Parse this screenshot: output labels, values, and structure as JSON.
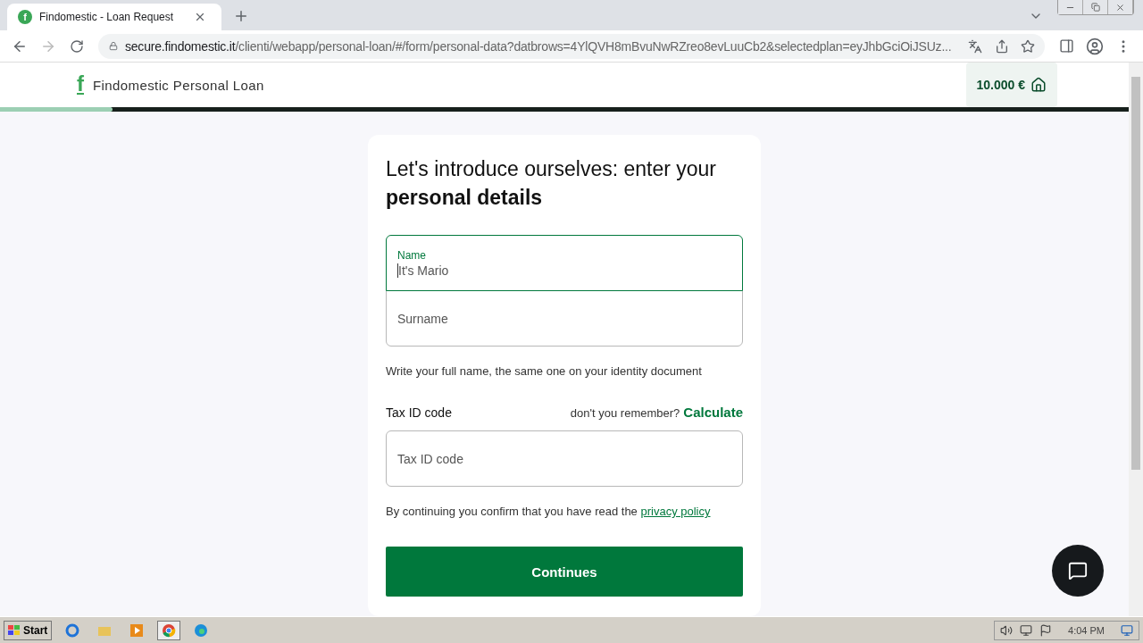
{
  "browser": {
    "tab": {
      "title": "Findomestic - Loan Request",
      "favicon": "f",
      "selected": true
    },
    "address": {
      "host": "secure.findomestic.it",
      "path": "/clienti/webapp/personal-loan/#/form/personal-data?datbrows=4YlQVH8mBvuNwRZreo8evLuuCb2&selectedplan=eyJhbGciOiJSUz..."
    }
  },
  "header": {
    "logo": "f",
    "brand": "Findomestic Personal Loan",
    "amount": "10.000 €",
    "progress": {
      "level": 0.1
    }
  },
  "form": {
    "heading": "Let's introduce ourselves: enter your **personal details**",
    "fields": [
      {
        "label": "Name",
        "placeholder": "It's Mario",
        "focused": true
      },
      {
        "placeholder": "Surname",
        "focused": false
      }
    ],
    "hint": "Write your full name, the same one on your identity document",
    "tax": {
      "label": "Tax ID code",
      "question": "don't you remember?",
      "link": "Calculate",
      "placeholder": "Tax ID code"
    },
    "consent": "By continuing you confirm that you have read the",
    "privacy_link": "privacy policy",
    "submit": "Continues"
  },
  "taskbar": {
    "start": "Start",
    "clock": "4:04 PM"
  }
}
